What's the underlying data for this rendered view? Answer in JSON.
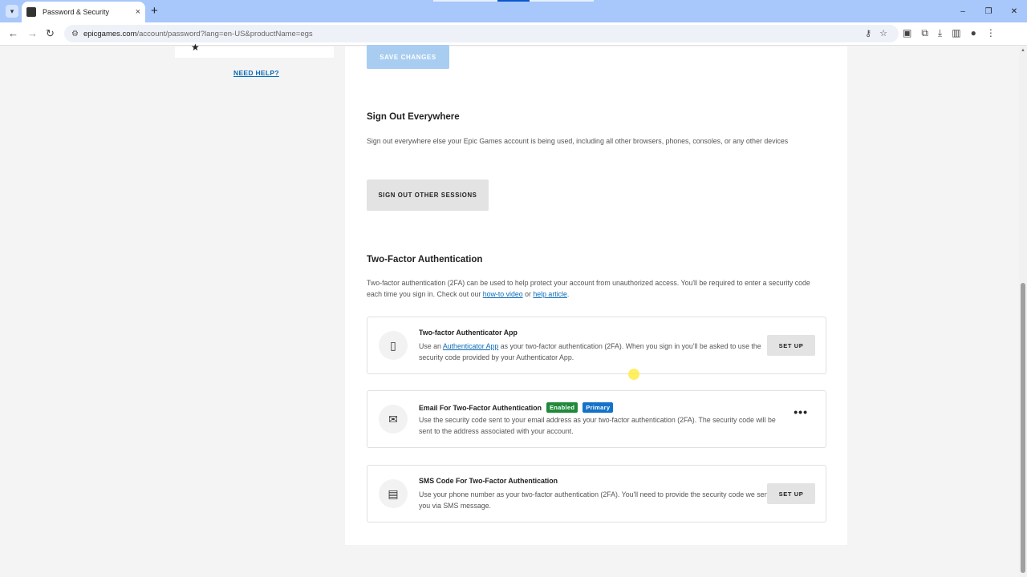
{
  "browser": {
    "tab_title": "Password & Security",
    "tab_close": "×",
    "new_tab": "+",
    "url_domain": "epicgames.com",
    "url_path": "/account/password?lang=en-US&productName=egs",
    "window_controls": [
      "–",
      "❐",
      "✕"
    ]
  },
  "sidebar": {
    "need_help": "NEED HELP?"
  },
  "main": {
    "save_changes": "SAVE CHANGES",
    "sign_out": {
      "title": "Sign Out Everywhere",
      "description": "Sign out everywhere else your Epic Games account is being used, including all other browsers, phones, consoles, or any other devices",
      "button": "SIGN OUT OTHER SESSIONS"
    },
    "two_factor": {
      "title": "Two-Factor Authentication",
      "desc_part1": "Two-factor authentication (2FA) can be used to help protect your account from unauthorized access. You'll be required to enter a security code each time you sign in. Check out our ",
      "link_video": "how-to video",
      "desc_or": " or ",
      "link_article": "help article",
      "desc_end": ".",
      "methods": [
        {
          "title": "Two-factor Authenticator App",
          "desc_pre": "Use an ",
          "desc_link": "Authenticator App",
          "desc_post": " as your two-factor authentication (2FA). When you sign in you'll be asked to use the security code provided by your Authenticator App.",
          "button": "SET UP",
          "icon": "phone-icon"
        },
        {
          "title": "Email For Two-Factor Authentication",
          "badge_enabled": "Enabled",
          "badge_primary": "Primary",
          "desc": "Use the security code sent to your email address as your two-factor authentication (2FA). The security code will be sent to the address associated with your account.",
          "more": "•••",
          "icon": "envelope-icon"
        },
        {
          "title": "SMS Code For Two-Factor Authentication",
          "desc": "Use your phone number as your two-factor authentication (2FA). You'll need to provide the security code we send you via SMS message.",
          "button": "SET UP",
          "icon": "sms-icon"
        }
      ]
    }
  },
  "colors": {
    "link": "#0a6bb8",
    "enabled_badge": "#1f8a3b",
    "primary_badge": "#1473c8",
    "tabbar": "#a8c7fa"
  }
}
